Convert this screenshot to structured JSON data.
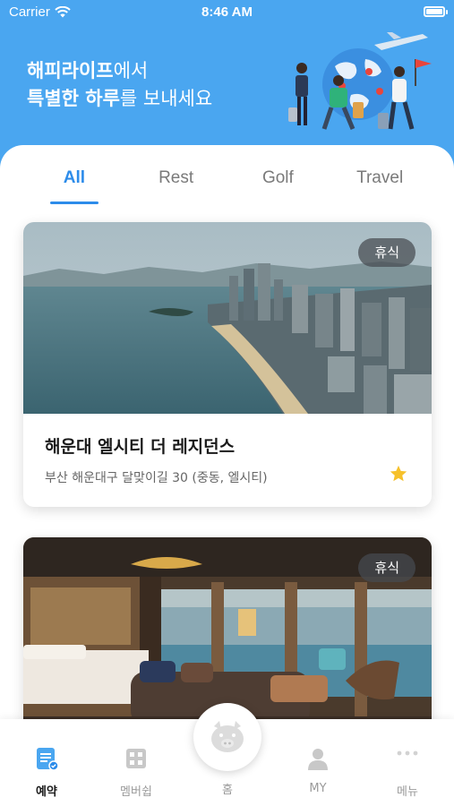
{
  "status": {
    "carrier": "Carrier",
    "time": "8:46 AM"
  },
  "hero": {
    "line1_bold": "해피라이프",
    "line1_rest": "에서",
    "line2_bold": "특별한 하루",
    "line2_rest": "를 보내세요"
  },
  "tabs": [
    {
      "label": "All",
      "active": true
    },
    {
      "label": "Rest",
      "active": false
    },
    {
      "label": "Golf",
      "active": false
    },
    {
      "label": "Travel",
      "active": false
    }
  ],
  "cards": [
    {
      "badge": "휴식",
      "title": "해운대 엘시티 더 레지던스",
      "address": "부산 해운대구 달맞이길 30 (중동, 엘시티)",
      "favorite": true
    },
    {
      "badge": "휴식"
    }
  ],
  "tabbar": [
    {
      "label": "예약",
      "icon": "reservation-icon",
      "active": true
    },
    {
      "label": "멤버쉽",
      "icon": "membership-icon",
      "active": false
    },
    {
      "label": "홈",
      "icon": "pig-home-icon",
      "active": false
    },
    {
      "label": "MY",
      "icon": "person-icon",
      "active": false
    },
    {
      "label": "메뉴",
      "icon": "more-dots-icon",
      "active": false
    }
  ],
  "colors": {
    "brand_blue": "#4aa6f0",
    "accent_blue": "#2d8cea",
    "star": "#f6c12c"
  }
}
